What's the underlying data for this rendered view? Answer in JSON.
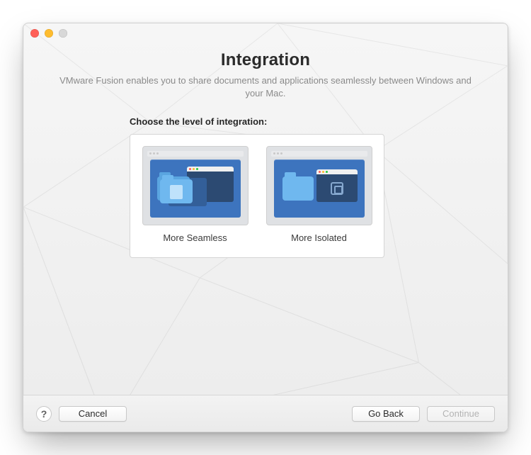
{
  "header": {
    "title": "Integration",
    "subtitle": "VMware Fusion enables you to share documents and applications seamlessly between Windows and your Mac."
  },
  "section": {
    "label": "Choose the level of integration:"
  },
  "options": {
    "seamless": {
      "label": "More Seamless"
    },
    "isolated": {
      "label": "More Isolated"
    }
  },
  "footer": {
    "help": "?",
    "cancel": "Cancel",
    "go_back": "Go Back",
    "continue": "Continue",
    "continue_enabled": false
  }
}
